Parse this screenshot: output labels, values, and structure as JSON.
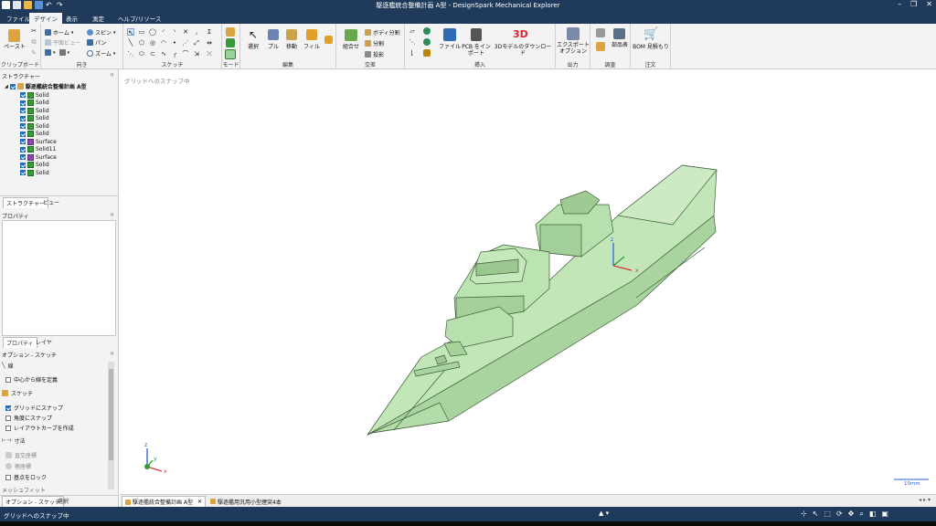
{
  "window": {
    "title": "駆逐艦統合整備計画 A型 - DesignSpark Mechanical Explorer",
    "controls": [
      "–",
      "❐",
      "✕"
    ]
  },
  "menu": {
    "tabs": [
      "ファイル",
      "デザイン",
      "表示",
      "測定",
      "ヘルプ/リソース"
    ],
    "active": "デザイン"
  },
  "ribbon": {
    "clipboard": {
      "paste": "ペースト",
      "group": "クリップボード"
    },
    "orient": {
      "home": "ホーム",
      "plane_view": "平面ビュー",
      "spin": "スピン",
      "pan": "パン",
      "zoom": "ズーム",
      "group": "向き"
    },
    "sketch": {
      "group": "スケッチ"
    },
    "mode": {
      "group": "モード"
    },
    "edit": {
      "select": "選択",
      "pull": "プル",
      "move": "移動",
      "fill": "フィル",
      "group": "編集"
    },
    "intersect": {
      "combine": "組合せ",
      "split_body": "ボディ分割",
      "split": "分割",
      "project": "投影",
      "group": "交差"
    },
    "insert": {
      "file": "ファイル",
      "pcb": "PCB をインポート",
      "download_3d": "3Dモデルのダウンロード",
      "badge_3d": "3D",
      "group": "挿入"
    },
    "output": {
      "export": "エクスポート オプション",
      "group": "出力"
    },
    "investigate": {
      "parts": "部品表",
      "group": "調査"
    },
    "order": {
      "bom": "BOM 見積もり",
      "group": "注文"
    }
  },
  "structure": {
    "header": "ストラクチャー",
    "root": "駆逐艦統合整備計画 A型",
    "items": [
      {
        "label": "Solid",
        "type": "solid"
      },
      {
        "label": "Solid",
        "type": "solid"
      },
      {
        "label": "Solid",
        "type": "solid"
      },
      {
        "label": "Solid",
        "type": "solid"
      },
      {
        "label": "Solid",
        "type": "solid"
      },
      {
        "label": "Solid",
        "type": "solid"
      },
      {
        "label": "Surface",
        "type": "surface"
      },
      {
        "label": "Solid11",
        "type": "solid"
      },
      {
        "label": "Surface",
        "type": "surface"
      },
      {
        "label": "Solid",
        "type": "solid"
      },
      {
        "label": "Solid",
        "type": "solid"
      }
    ],
    "tabs": [
      "ストラクチャー",
      "ビュー"
    ]
  },
  "properties": {
    "header": "プロパティ",
    "tabs": [
      "プロパティ",
      "レイヤ"
    ]
  },
  "options": {
    "header": "オプション - スケッチ",
    "line": "線",
    "define_from_center": "中心から線を定義",
    "sketch": "スケッチ",
    "snap_grid": "グリッドにスナップ",
    "snap_angle": "角度にスナップ",
    "layout_curve": "レイアウトカーブを作成",
    "dimension": "寸法",
    "cartesian": "直交座標",
    "polar": "極座標",
    "lock_ref": "基点をロック",
    "mesh_fit": "メッシュフィット",
    "bottom_tabs": [
      "オプション - スケッチ",
      "選択"
    ]
  },
  "viewport": {
    "hint": "グリッドへのスナップ中",
    "scale_label": "10mm",
    "model_color": "#bfe3b6"
  },
  "doc_tabs": [
    "駆逐艦統合整備計画 A型",
    "駆逐艦用汎用小型煙突4本"
  ],
  "status": {
    "text": "グリッドへのスナップ中"
  }
}
